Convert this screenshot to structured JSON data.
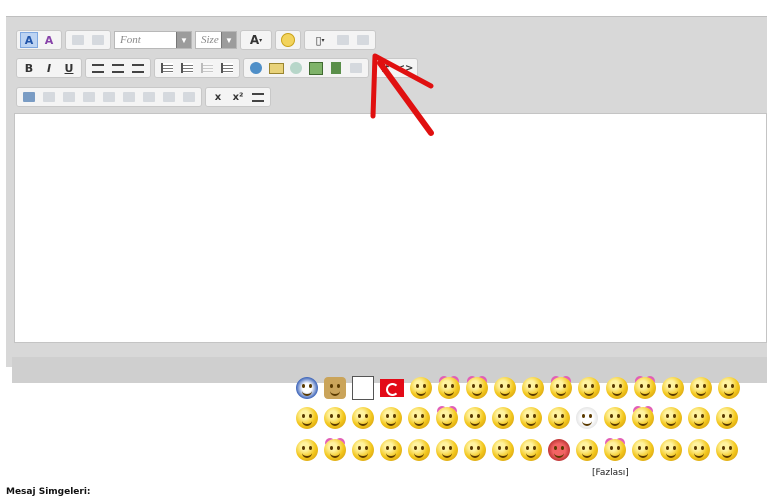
{
  "editor": {
    "toolbar": {
      "font_placeholder": "Font",
      "size_placeholder": "Size"
    },
    "buttons": {
      "bold": "B",
      "italic": "I",
      "underline": "U",
      "font_color": "A",
      "source": "#",
      "code": "<>",
      "subscript": "x",
      "superscript": "x²"
    }
  },
  "smilies": {
    "more_link": "[Fazlası]",
    "section_label": "Mesaj Simgeleri:"
  },
  "colors": {
    "annotation_arrow": "#e01010",
    "editor_bg": "#d8d8d8"
  }
}
